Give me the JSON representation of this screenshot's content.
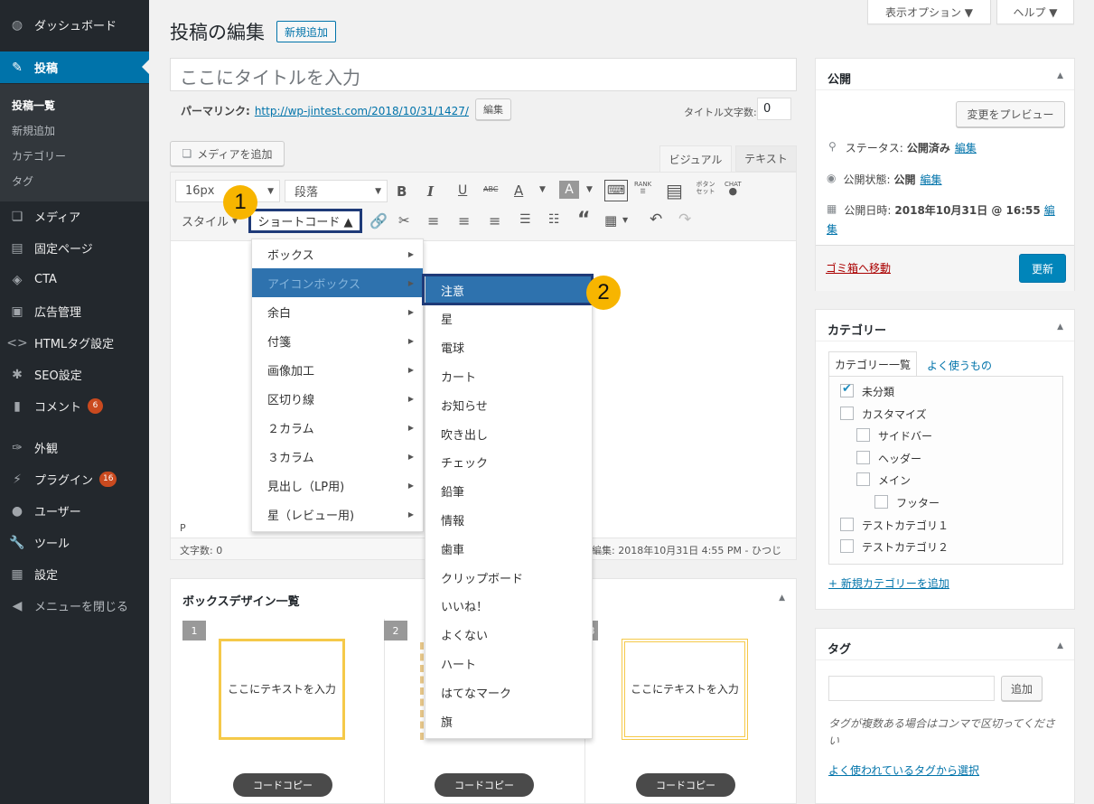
{
  "sidebar": {
    "items": [
      {
        "label": "ダッシュボード",
        "icon": "dashboard-icon",
        "glyph": "◍"
      },
      {
        "label": "投稿",
        "icon": "post-icon",
        "glyph": "✎"
      },
      {
        "label": "メディア",
        "icon": "media-icon",
        "glyph": "❏"
      },
      {
        "label": "固定ページ",
        "icon": "page-icon",
        "glyph": "▤"
      },
      {
        "label": "CTA",
        "icon": "tag-icon",
        "glyph": "◈"
      },
      {
        "label": "広告管理",
        "icon": "ad-icon",
        "glyph": "▣"
      },
      {
        "label": "HTMLタグ設定",
        "icon": "code-icon",
        "glyph": "<>"
      },
      {
        "label": "SEO設定",
        "icon": "gear-icon",
        "glyph": "✱"
      },
      {
        "label": "コメント",
        "icon": "comment-icon",
        "glyph": "▮",
        "badge": "6"
      },
      {
        "label": "外観",
        "icon": "brush-icon",
        "glyph": "✑"
      },
      {
        "label": "プラグイン",
        "icon": "plugin-icon",
        "glyph": "⚡",
        "badge": "16"
      },
      {
        "label": "ユーザー",
        "icon": "user-icon",
        "glyph": "●"
      },
      {
        "label": "ツール",
        "icon": "wrench-icon",
        "glyph": "🔧"
      },
      {
        "label": "設定",
        "icon": "settings-icon",
        "glyph": "▦"
      },
      {
        "label": "メニューを閉じる",
        "icon": "collapse-icon",
        "glyph": "◀"
      }
    ],
    "submenu": [
      "投稿一覧",
      "新規追加",
      "カテゴリー",
      "タグ"
    ]
  },
  "top": {
    "screen_options": "表示オプション ▼",
    "help": "ヘルプ ▼"
  },
  "page": {
    "title": "投稿の編集",
    "add_new": "新規追加"
  },
  "post": {
    "title_placeholder": "ここにタイトルを入力",
    "permalink_label": "パーマリンク:",
    "permalink_url": "http://wp-jintest.com/2018/10/31/1427/",
    "edit_btn": "編集",
    "title_count_label": "タイトル文字数:",
    "title_count": "0",
    "add_media": "メディアを追加",
    "tab_visual": "ビジュアル",
    "tab_text": "テキスト"
  },
  "toolbar": {
    "font_size": "16px",
    "paragraph": "段落",
    "style": "スタイル",
    "shortcode": "ショートコード ▲",
    "rank": "RANK",
    "button_set": "ボタン\nセット",
    "chat": "CHAT"
  },
  "editor": {
    "path": "P",
    "word_count": "文字数: 0",
    "last_edit": "編集: 2018年10月31日 4:55 PM - ひつじ"
  },
  "shortcode_menu": [
    "ボックス",
    "アイコンボックス",
    "余白",
    "付箋",
    "画像加工",
    "区切り線",
    "２カラム",
    "３カラム",
    "見出し（LP用)",
    "星（レビュー用)"
  ],
  "iconbox_menu": [
    "注意",
    "星",
    "電球",
    "カート",
    "お知らせ",
    "吹き出し",
    "チェック",
    "鉛筆",
    "情報",
    "歯車",
    "クリップボード",
    "いいね！",
    "よくない",
    "ハート",
    "はてなマーク",
    "旗"
  ],
  "callouts": [
    "1",
    "2"
  ],
  "box_design": {
    "title": "ボックスデザイン一覧",
    "items": [
      {
        "num": "1",
        "text": "ここにテキストを入力",
        "copy": "コードコピー"
      },
      {
        "num": "2",
        "text": "",
        "copy": "コードコピー"
      },
      {
        "num": "3",
        "text": "ここにテキストを入力",
        "copy": "コードコピー"
      }
    ]
  },
  "publish": {
    "title": "公開",
    "preview": "変更をプレビュー",
    "status_label": "ステータス:",
    "status_value": "公開済み",
    "visibility_label": "公開状態:",
    "visibility_value": "公開",
    "date_label": "公開日時:",
    "date_value": "2018年10月31日 @ 16:55",
    "edit": "編集",
    "edit_date_1": "編",
    "edit_date_2": "集",
    "trash": "ゴミ箱へ移動",
    "update": "更新"
  },
  "categories": {
    "title": "カテゴリー",
    "tab_all": "カテゴリー一覧",
    "tab_popular": "よく使うもの",
    "items": [
      {
        "label": "未分類",
        "checked": true
      },
      {
        "label": "カスタマイズ",
        "checked": false
      },
      {
        "label": "サイドバー",
        "checked": false
      },
      {
        "label": "ヘッダー",
        "checked": false
      },
      {
        "label": "メイン",
        "checked": false
      },
      {
        "label": "フッター",
        "checked": false
      },
      {
        "label": "テストカテゴリ１",
        "checked": false
      },
      {
        "label": "テストカテゴリ２",
        "checked": false
      }
    ],
    "add_new": "+ 新規カテゴリーを追加"
  },
  "tags": {
    "title": "タグ",
    "add": "追加",
    "hint": "タグが複数ある場合はコンマで区切ってください",
    "popular": "よく使われているタグから選択"
  },
  "colors": {
    "accent": "#0073aa",
    "sidebar": "#23282d",
    "callout": "#f7b500",
    "highlight": "#2e72ae"
  }
}
